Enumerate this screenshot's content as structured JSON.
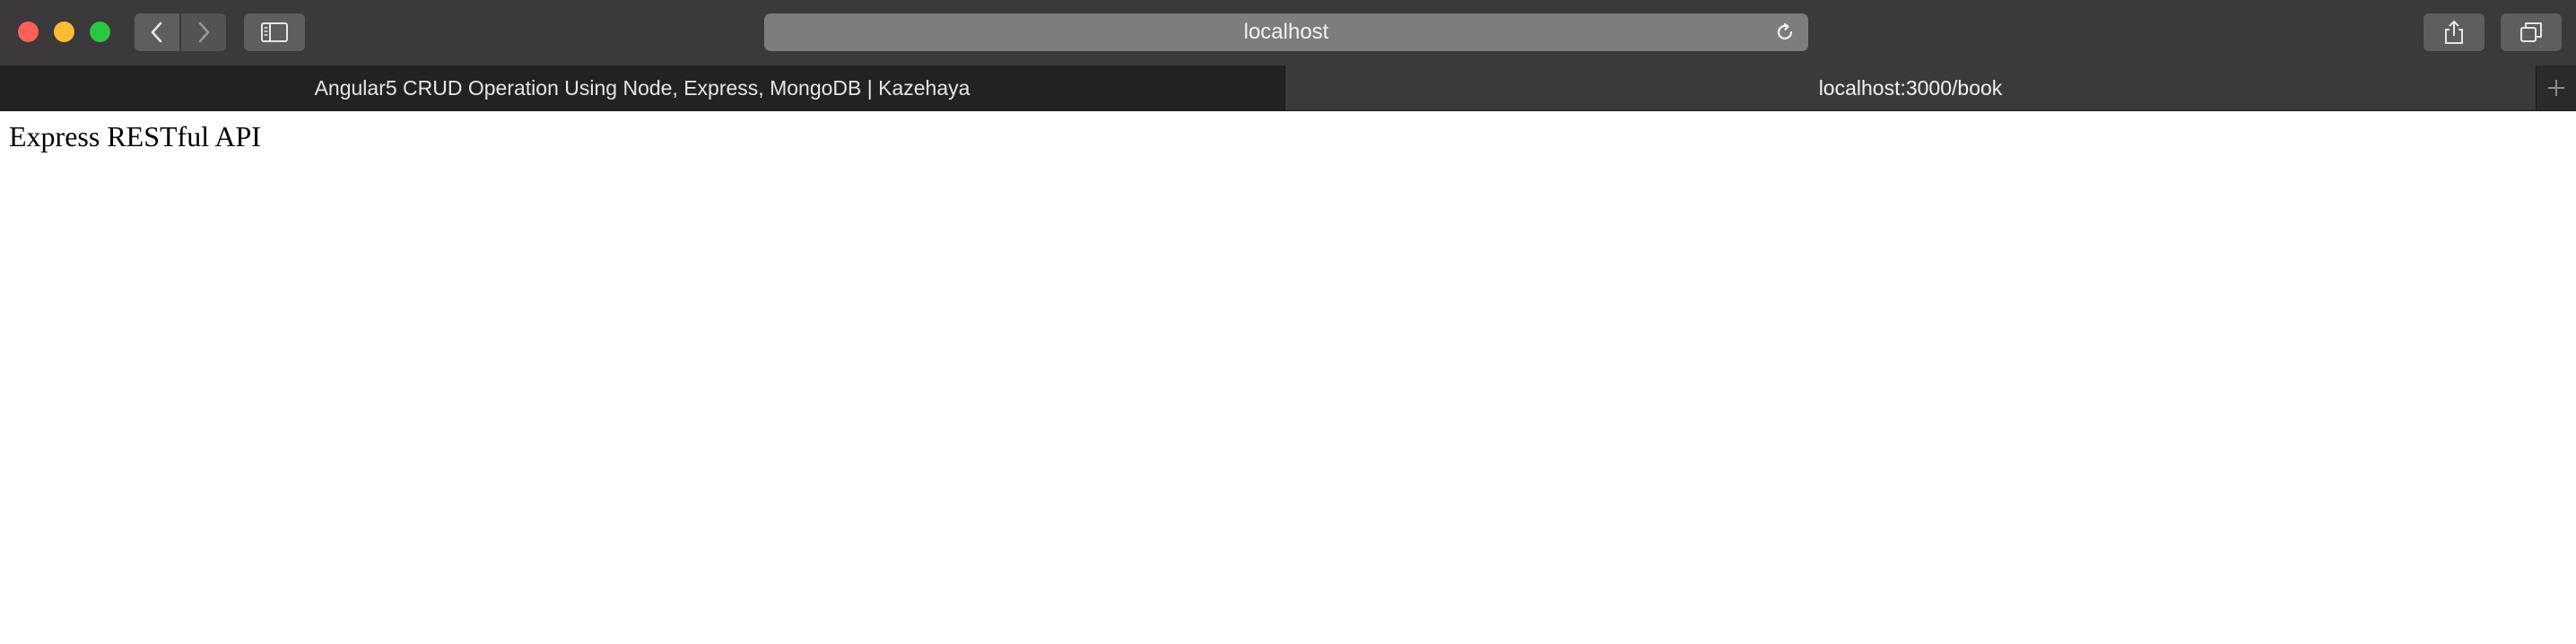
{
  "toolbar": {
    "address": "localhost"
  },
  "icons": {
    "back": "chevron-left-icon",
    "forward": "chevron-right-icon",
    "sidebar": "sidebar-icon",
    "reload": "reload-icon",
    "share": "share-icon",
    "tabs": "tabs-overview-icon",
    "new_tab": "plus-icon"
  },
  "tabs": [
    {
      "label": "Angular5 CRUD Operation Using Node, Express, MongoDB | Kazehaya",
      "active": false
    },
    {
      "label": "localhost:3000/book",
      "active": true
    }
  ],
  "page": {
    "body_text": "Express RESTful API"
  },
  "colors": {
    "close": "#fe5f57",
    "minimize": "#febc2e",
    "maximize": "#28c840",
    "toolbar": "#3b393b",
    "address_bar": "#7e7c7e"
  }
}
